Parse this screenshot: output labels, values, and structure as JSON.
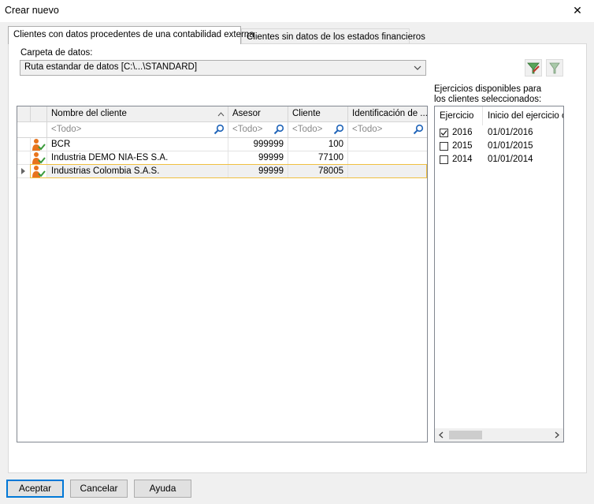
{
  "window": {
    "title": "Crear nuevo",
    "close_glyph": "✕"
  },
  "tabs": [
    {
      "label": "Clientes con datos procedentes de una contabilidad externa"
    },
    {
      "label": "Clientes sin datos de los estados financieros"
    }
  ],
  "data_folder": {
    "label": "Carpeta de datos:",
    "selected": "Ruta estandar de datos [C:\\...\\STANDARD]"
  },
  "grid": {
    "columns": [
      "Nombre del cliente",
      "Asesor",
      "Cliente",
      "Identificación de ..."
    ],
    "filter_placeholder": "<Todo>",
    "rows": [
      {
        "name": "BCR",
        "asesor": "999999",
        "cliente": "100",
        "id": ""
      },
      {
        "name": "Industria DEMO NIA-ES S.A.",
        "asesor": "99999",
        "cliente": "77100",
        "id": ""
      },
      {
        "name": "Industrias Colombia S.A.S.",
        "asesor": "99999",
        "cliente": "78005",
        "id": ""
      }
    ]
  },
  "fiscal_years": {
    "label": "Ejercicios disponibles para los clientes seleccionados:",
    "columns": [
      "Ejercicio",
      "Inicio del ejercicio co"
    ],
    "rows": [
      {
        "year": "2016",
        "start": "01/01/2016",
        "checked": true
      },
      {
        "year": "2015",
        "start": "01/01/2015",
        "checked": false
      },
      {
        "year": "2014",
        "start": "01/01/2014",
        "checked": false
      }
    ]
  },
  "buttons": {
    "accept": "Aceptar",
    "cancel": "Cancelar",
    "help": "Ayuda"
  },
  "colors": {
    "accent": "#0078d7",
    "selection_border": "#f0c040",
    "icon_orange": "#e8741c",
    "icon_green": "#3a9a3a"
  }
}
